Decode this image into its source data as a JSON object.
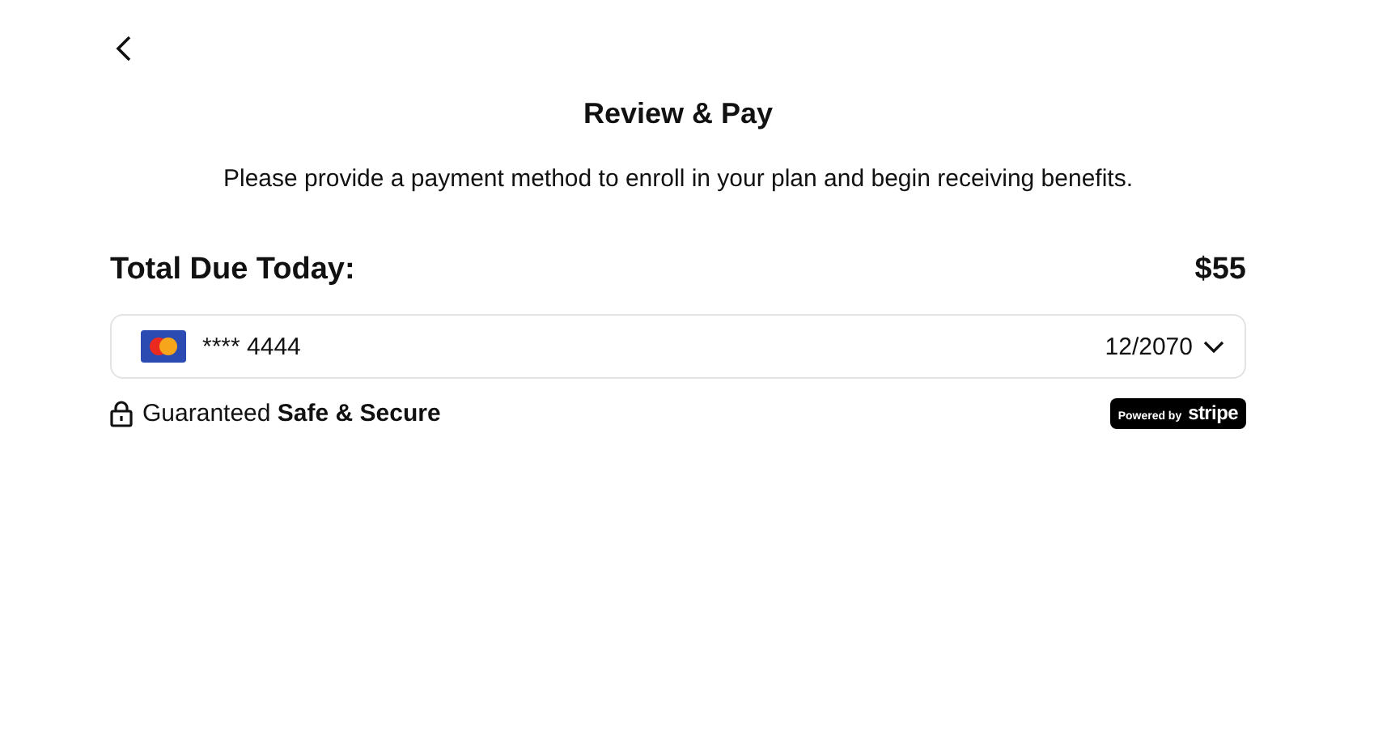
{
  "title": "Review & Pay",
  "description": "Please provide a payment method to enroll in your plan and begin receiving benefits.",
  "total": {
    "label": "Total Due Today:",
    "amount": "$55"
  },
  "card": {
    "number": "**** 4444",
    "expiry": "12/2070"
  },
  "security": "Guaranteed **Safe & Secure**",
  "badge": {
    "prefix": "Powered by",
    "brand": "stripe"
  }
}
